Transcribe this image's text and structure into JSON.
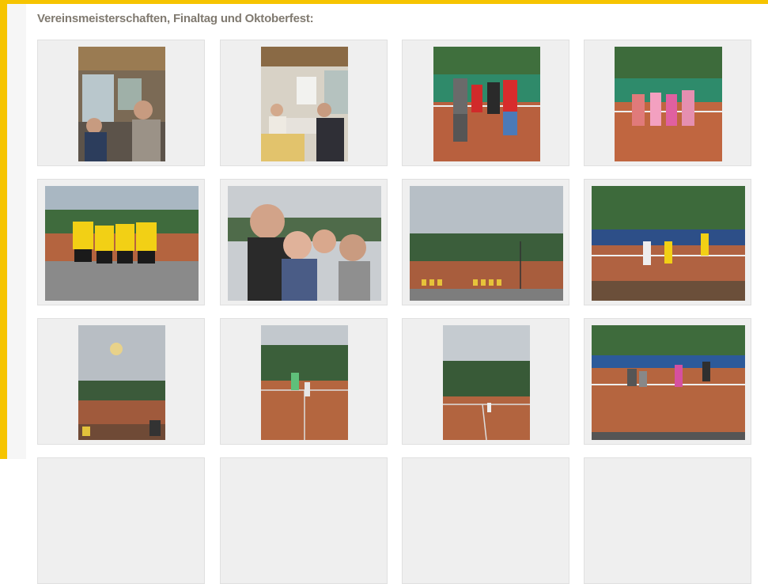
{
  "section": {
    "heading": "Vereinsmeisterschaften, Finaltag und Oktoberfest:"
  },
  "colors": {
    "frame": "#f6c400",
    "heading": "#807a70",
    "tile_background": "#efefef",
    "clay_court": "#b8603e",
    "jersey_yellow": "#f2d015"
  },
  "gallery": {
    "photo_count": 12,
    "subjects": [
      "clubhouse-interior",
      "clubhouse-interior",
      "players-on-court",
      "players-on-court",
      "team-yellow-shirts",
      "group-selfie",
      "empty-courts",
      "players-at-net",
      "sunset-sky",
      "player-on-court",
      "court-with-trees",
      "court-with-net"
    ]
  }
}
